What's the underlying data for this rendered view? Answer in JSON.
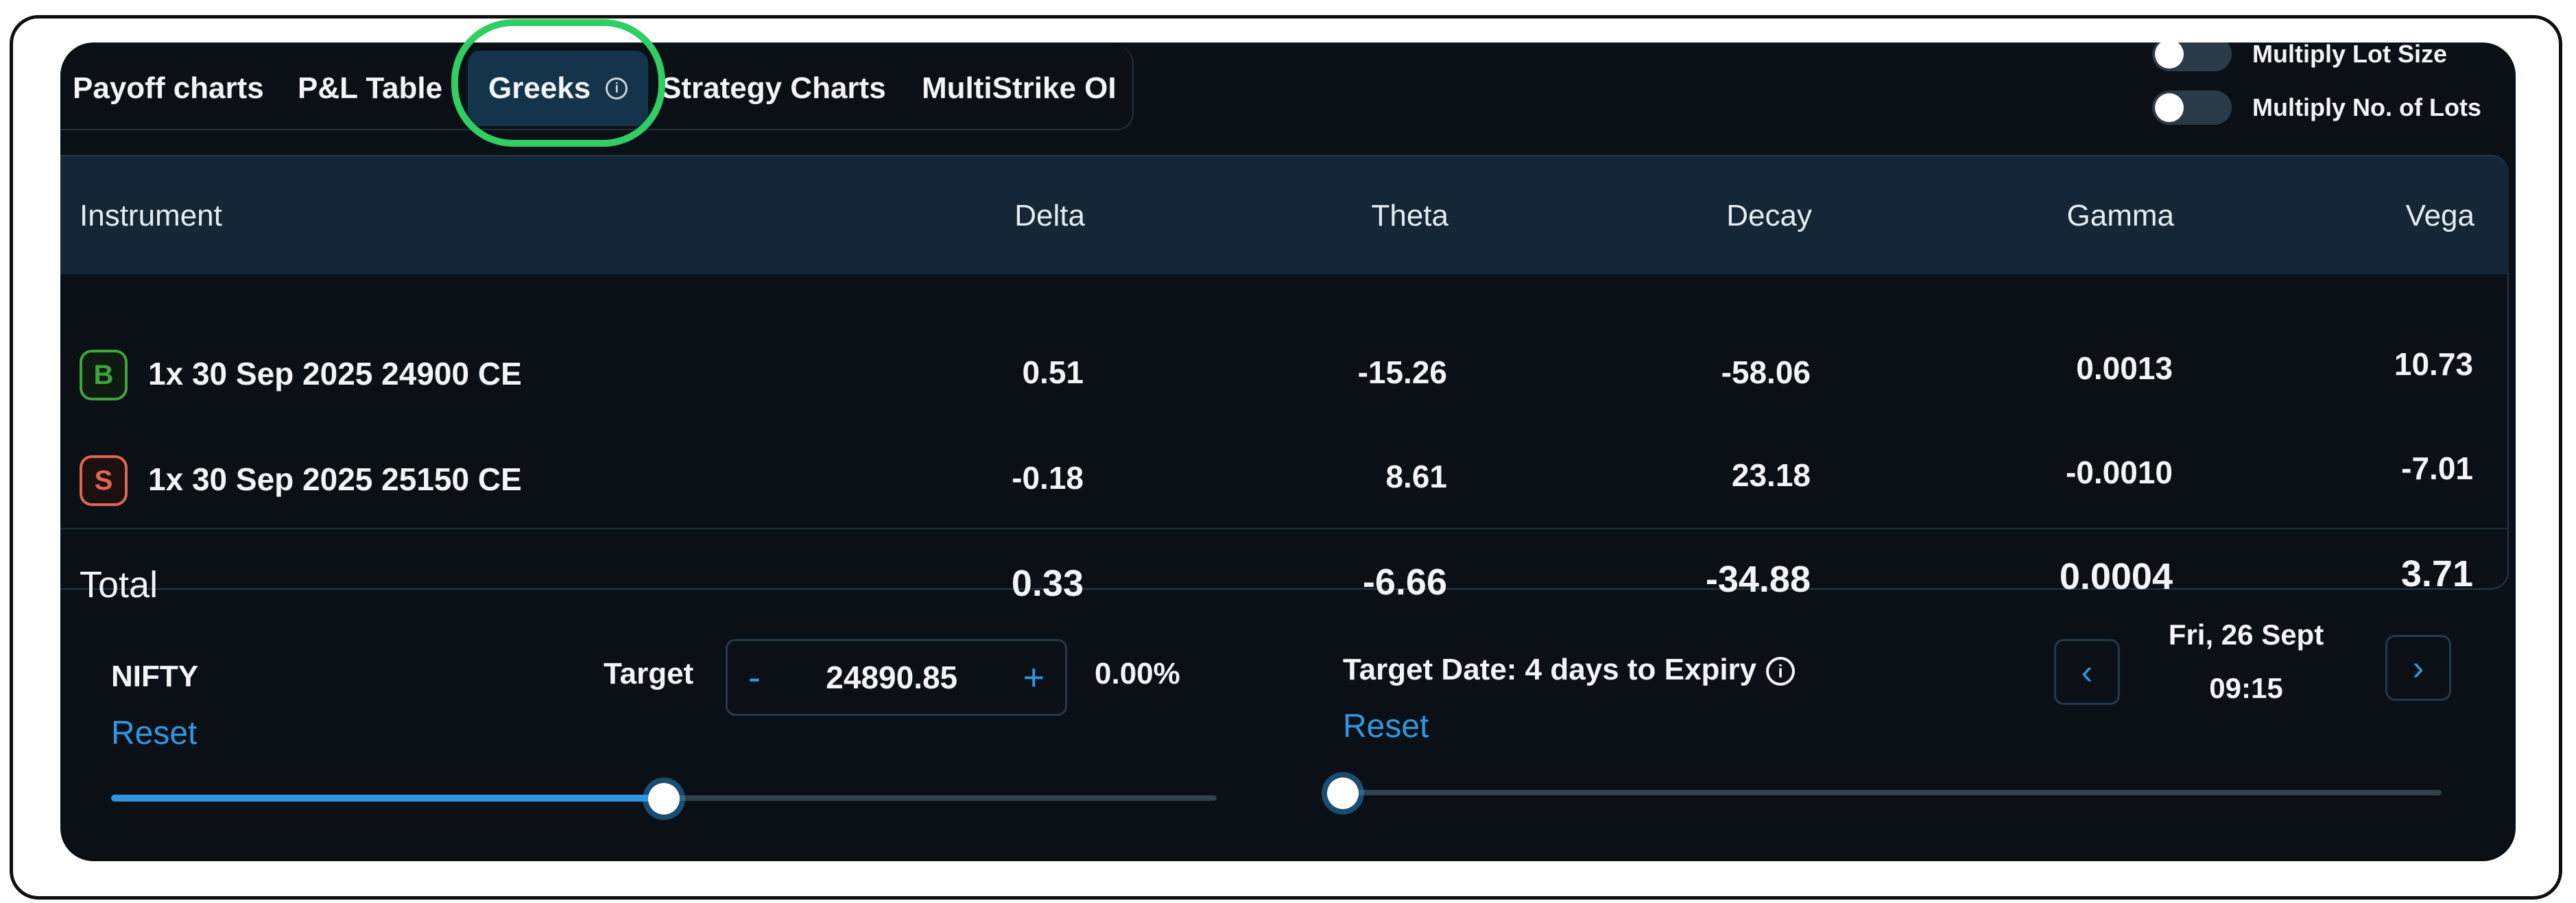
{
  "tabs": [
    {
      "label": "Payoff charts"
    },
    {
      "label": "P&L Table"
    },
    {
      "label": "Greeks",
      "active": true
    },
    {
      "label": "Strategy Charts"
    },
    {
      "label": "MultiStrike OI"
    }
  ],
  "toggles": {
    "lot_size": {
      "label": "Multiply Lot Size",
      "on": false
    },
    "no_of_lots": {
      "label": "Multiply No. of Lots",
      "on": false
    }
  },
  "table": {
    "headers": [
      "Instrument",
      "Delta",
      "Theta",
      "Decay",
      "Gamma",
      "Vega"
    ],
    "rows": [
      {
        "side": "B",
        "instrument": "1x 30 Sep 2025 24900 CE",
        "delta": "0.51",
        "theta": "-15.26",
        "decay": "-58.06",
        "gamma": "0.0013",
        "vega": "10.73"
      },
      {
        "side": "S",
        "instrument": "1x 30 Sep 2025 25150 CE",
        "delta": "-0.18",
        "theta": "8.61",
        "decay": "23.18",
        "gamma": "-0.0010",
        "vega": "-7.01"
      }
    ],
    "total": {
      "label": "Total",
      "delta": "0.33",
      "theta": "-6.66",
      "decay": "-34.88",
      "gamma": "0.0004",
      "vega": "3.71"
    }
  },
  "controls": {
    "underlying": "NIFTY",
    "reset": "Reset",
    "target_label": "Target",
    "minus": "-",
    "target_value": "24890.85",
    "plus": "+",
    "target_pct": "0.00%",
    "target_slider_fraction": 0.5,
    "target_date_label": "Target Date: 4 days to Expiry",
    "date_reset": "Reset",
    "date_line1": "Fri, 26 Sept",
    "date_line2": "09:15",
    "date_slider_fraction": 0.0
  },
  "colors": {
    "background": "#0b1016",
    "header": "#152737",
    "accent": "#2f97e0",
    "buy": "#3fa53b",
    "sell": "#e0674f",
    "highlight": "#2fcf63"
  },
  "icons": {
    "info": "info-icon",
    "prev": "chevron-left-icon",
    "next": "chevron-right-icon"
  }
}
